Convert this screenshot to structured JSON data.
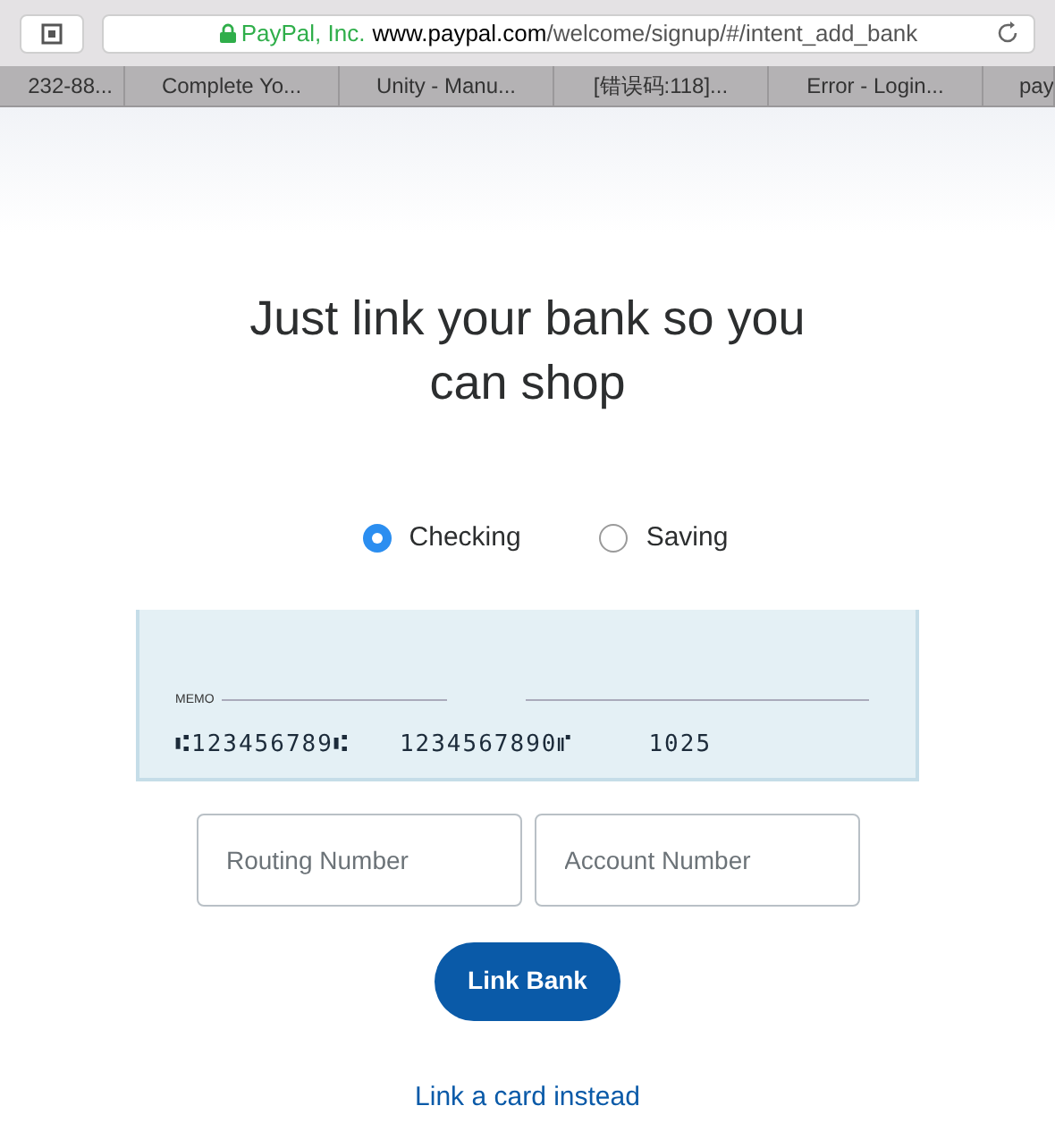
{
  "browser": {
    "url_owner": "PayPal, Inc.",
    "url_host": "www.paypal.com",
    "url_path": "/welcome/signup/#/intent_add_bank",
    "tabs": [
      {
        "label": "232-88...",
        "selected": false
      },
      {
        "label": "Complete Yo...",
        "selected": false
      },
      {
        "label": "Unity - Manu...",
        "selected": false
      },
      {
        "label": "[错误码:118]...",
        "selected": false
      },
      {
        "label": "Error - Login...",
        "selected": false
      },
      {
        "label": "pay",
        "selected": false
      }
    ]
  },
  "heading": "Just link your bank so you can shop",
  "account_types": [
    {
      "label": "Checking",
      "selected": true
    },
    {
      "label": "Saving",
      "selected": false
    }
  ],
  "check": {
    "memo_label": "MEMO",
    "routing": "⑆123456789⑆",
    "account": "1234567890⑈",
    "check_number": "1025"
  },
  "fields": [
    {
      "placeholder": "Routing Number"
    },
    {
      "placeholder": "Account Number"
    }
  ],
  "submit": "Link Bank",
  "alt_link": "Link a card instead"
}
